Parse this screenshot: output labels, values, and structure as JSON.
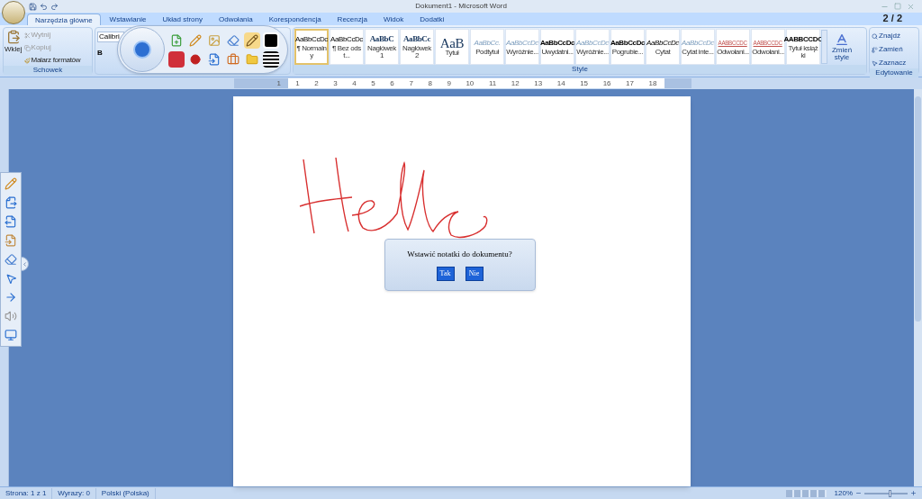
{
  "window": {
    "title": "Dokument1 - Microsoft Word",
    "page_counter": "2 / 2"
  },
  "tabs": [
    {
      "label": "Narzędzia główne",
      "selected": true
    },
    {
      "label": "Wstawianie",
      "selected": false
    },
    {
      "label": "Układ strony",
      "selected": false
    },
    {
      "label": "Odwołania",
      "selected": false
    },
    {
      "label": "Korespondencja",
      "selected": false
    },
    {
      "label": "Recenzja",
      "selected": false
    },
    {
      "label": "Widok",
      "selected": false
    },
    {
      "label": "Dodatki",
      "selected": false
    }
  ],
  "clipboard": {
    "paste": "Wklej",
    "cut": "Wytnij",
    "copy": "Kopiuj",
    "painter": "Malarz formatów",
    "group": "Schowek"
  },
  "font": {
    "name": "Calibri",
    "bold": "B"
  },
  "styles": {
    "group": "Style",
    "change": "Zmień style",
    "items": [
      {
        "sample": "AaBbCcDc",
        "name": "¶ Normalny",
        "kind": "normal",
        "selected": true
      },
      {
        "sample": "AaBbCcDc",
        "name": "¶ Bez odst...",
        "kind": "normal",
        "selected": false
      },
      {
        "sample": "AaBbC",
        "name": "Nagłówek 1",
        "kind": "heading",
        "selected": false
      },
      {
        "sample": "AaBbCc",
        "name": "Nagłówek 2",
        "kind": "heading",
        "selected": false
      },
      {
        "sample": "AaB",
        "name": "Tytuł",
        "kind": "title",
        "selected": false
      },
      {
        "sample": "AaBbCc.",
        "name": "Podtytuł",
        "kind": "subtle",
        "selected": false
      },
      {
        "sample": "AaBbCcDc",
        "name": "Wyróżnie...",
        "kind": "subtle",
        "selected": false
      },
      {
        "sample": "AaBbCcDc",
        "name": "Uwydatni...",
        "kind": "strong",
        "selected": false
      },
      {
        "sample": "AaBbCcDc",
        "name": "Wyróżnie...",
        "kind": "subtle",
        "selected": false
      },
      {
        "sample": "AaBbCcDc",
        "name": "Pogrubie...",
        "kind": "strong",
        "selected": false
      },
      {
        "sample": "AaBbCcDc",
        "name": "Cytat",
        "kind": "quote",
        "selected": false
      },
      {
        "sample": "AaBbCcDc",
        "name": "Cytat inte...",
        "kind": "subtle",
        "selected": false
      },
      {
        "sample": "AABBCCDC",
        "name": "Odwołani...",
        "kind": "reference",
        "selected": false
      },
      {
        "sample": "AABBCCDC",
        "name": "Odwołani...",
        "kind": "reference",
        "selected": false
      },
      {
        "sample": "AABBCCDC",
        "name": "Tytuł książki",
        "kind": "strong",
        "selected": false
      }
    ]
  },
  "editing": {
    "group": "Edytowanie",
    "find": "Znajdź",
    "replace": "Zamień",
    "select": "Zaznacz"
  },
  "ruler": {
    "left_marks": [
      "1"
    ],
    "right_marks": [
      "1",
      "2",
      "3",
      "4",
      "5",
      "6",
      "7",
      "8",
      "9",
      "10",
      "11",
      "12",
      "13",
      "14",
      "15",
      "16",
      "17",
      "18"
    ]
  },
  "dialog": {
    "message": "Wstawić notatki do dokumentu?",
    "buttons": [
      "Tak",
      "Nie"
    ]
  },
  "status_bar": {
    "items": [
      "Strona: 1 z 1",
      "Wyrazy: 0",
      "Polski (Polska)"
    ],
    "zoom": "120%",
    "zoom_level": {
      "level": 0.6
    }
  }
}
